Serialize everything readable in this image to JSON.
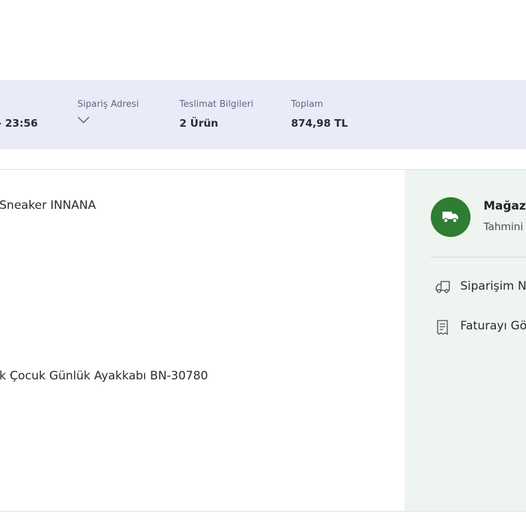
{
  "summary": {
    "date_fragment": "- 23:56",
    "address": {
      "label": "Sipariş Adresi"
    },
    "delivery": {
      "label": "Teslimat Bilgileri",
      "value": "2 Ürün"
    },
    "total": {
      "label": "Toplam",
      "value": "874,98 TL"
    }
  },
  "products": [
    {
      "name": "Sneaker INNANA"
    },
    {
      "name": "k Çocuk Günlük Ayakkabı BN-30780"
    }
  ],
  "side_panel": {
    "accent_color": "#2e7d32",
    "store_title": "Mağaza",
    "store_subtitle": "Tahmini",
    "links": [
      {
        "label": "Siparişim N",
        "icon": "truck-outline-icon"
      },
      {
        "label": "Faturayı Gö",
        "icon": "receipt-icon"
      }
    ]
  }
}
